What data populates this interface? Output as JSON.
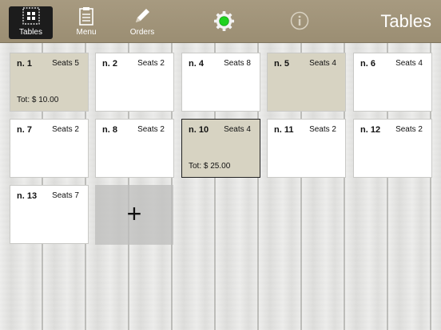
{
  "toolbar": {
    "tabs": [
      {
        "label": "Tables",
        "icon": "grid-icon",
        "active": true
      },
      {
        "label": "Menu",
        "icon": "clipboard-icon",
        "active": false
      },
      {
        "label": "Orders",
        "icon": "pencil-icon",
        "active": false
      }
    ],
    "title": "Tables",
    "status_color": "#1fd21f",
    "bar_color": "#a09378"
  },
  "tables": [
    {
      "name": "n. 1",
      "seats": "Seats 5",
      "total": "Tot: $ 10.00",
      "occupied": true
    },
    {
      "name": "n. 2",
      "seats": "Seats 2",
      "total": "",
      "occupied": false
    },
    {
      "name": "n. 4",
      "seats": "Seats 8",
      "total": "",
      "occupied": false
    },
    {
      "name": "n. 5",
      "seats": "Seats 4",
      "total": "",
      "occupied": true
    },
    {
      "name": "n. 6",
      "seats": "Seats 4",
      "total": "",
      "occupied": false
    },
    {
      "name": "n. 7",
      "seats": "Seats 2",
      "total": "",
      "occupied": false
    },
    {
      "name": "n. 8",
      "seats": "Seats 2",
      "total": "",
      "occupied": false
    },
    {
      "name": "n. 10",
      "seats": "Seats 4",
      "total": "Tot: $ 25.00",
      "occupied": true,
      "selected": true
    },
    {
      "name": "n. 11",
      "seats": "Seats 2",
      "total": "",
      "occupied": false
    },
    {
      "name": "n. 12",
      "seats": "Seats 2",
      "total": "",
      "occupied": false
    },
    {
      "name": "n. 13",
      "seats": "Seats 7",
      "total": "",
      "occupied": false
    }
  ],
  "add_table": {
    "label": "+"
  }
}
